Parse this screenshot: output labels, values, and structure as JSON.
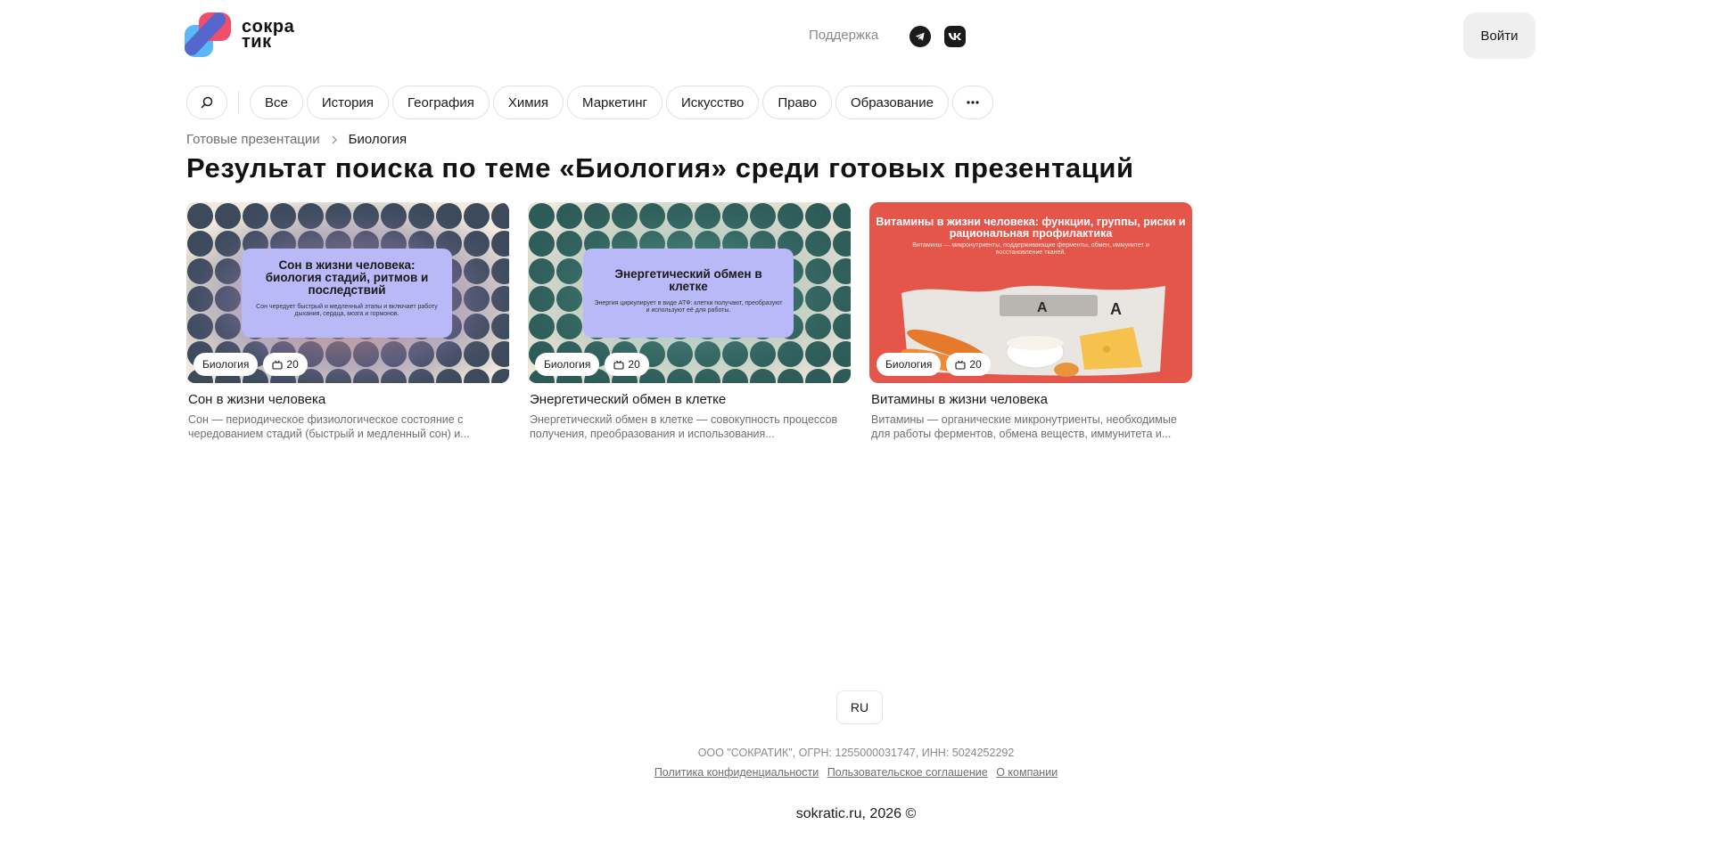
{
  "header": {
    "logo_line1": "сокра",
    "logo_line2": "тик",
    "support": "Поддержка",
    "login": "Войти"
  },
  "tags": [
    "Все",
    "История",
    "География",
    "Химия",
    "Маркетинг",
    "Искусство",
    "Право",
    "Образование"
  ],
  "icons": [
    "search-icon",
    "telegram-icon",
    "vk-icon",
    "more-icon",
    "chevron-right-icon",
    "slides-icon"
  ],
  "breadcrumb": {
    "parent": "Готовые презентации",
    "current": "Биология"
  },
  "title": "Результат поиска по теме «Биология» среди готовых презентаций",
  "cards": [
    {
      "slide_title": "Сон в жизни человека: биология стадий, ритмов и последствий",
      "slide_sub": "Сон чередует быстрый и медленный этапы и включает работу дыхания, сердца, мозга и гормонов.",
      "category": "Биология",
      "slides": "20",
      "title": "Сон в жизни человека",
      "desc": "Сон — периодическое физиологическое состояние с чередованием стадий (быстрый и медленный сон) и..."
    },
    {
      "slide_title": "Энергетический обмен в клетке",
      "slide_sub": "Энергия циркулирует в виде АТФ: клетки получают, преобразуют и используют её для работы.",
      "category": "Биология",
      "slides": "20",
      "title": "Энергетический обмен в клетке",
      "desc": "Энергетический обмен в клетке — совокупность процессов получения, преобразования и использования..."
    },
    {
      "slide_title": "Витамины в жизни человека: функции, группы, риски и рациональная профилактика",
      "slide_sub": "Витамины — микронутриенты, поддерживающие ферменты, обмен, иммунитет и восстановление тканей.",
      "category": "Биология",
      "slides": "20",
      "title": "Витамины в жизни человека",
      "desc": "Витамины — органические микронутриенты, необходимые для работы ферментов, обмена веществ, иммунитета и..."
    }
  ],
  "footer": {
    "lang": "RU",
    "company": "ООО \"СОКРАТИК\", ОГРН: 1255000031747, ИНН: 5024252292",
    "privacy": "Политика конфиденциальности",
    "terms": "Пользовательское соглашение",
    "about": "О компании",
    "copyright": "sokratic.ru, 2026 ©"
  },
  "colors": {
    "accent_red": "#e4554a",
    "slide_box": "#b9b9f7",
    "logo_pink": "#ef4f6c",
    "logo_blue": "#5b8ff2"
  }
}
